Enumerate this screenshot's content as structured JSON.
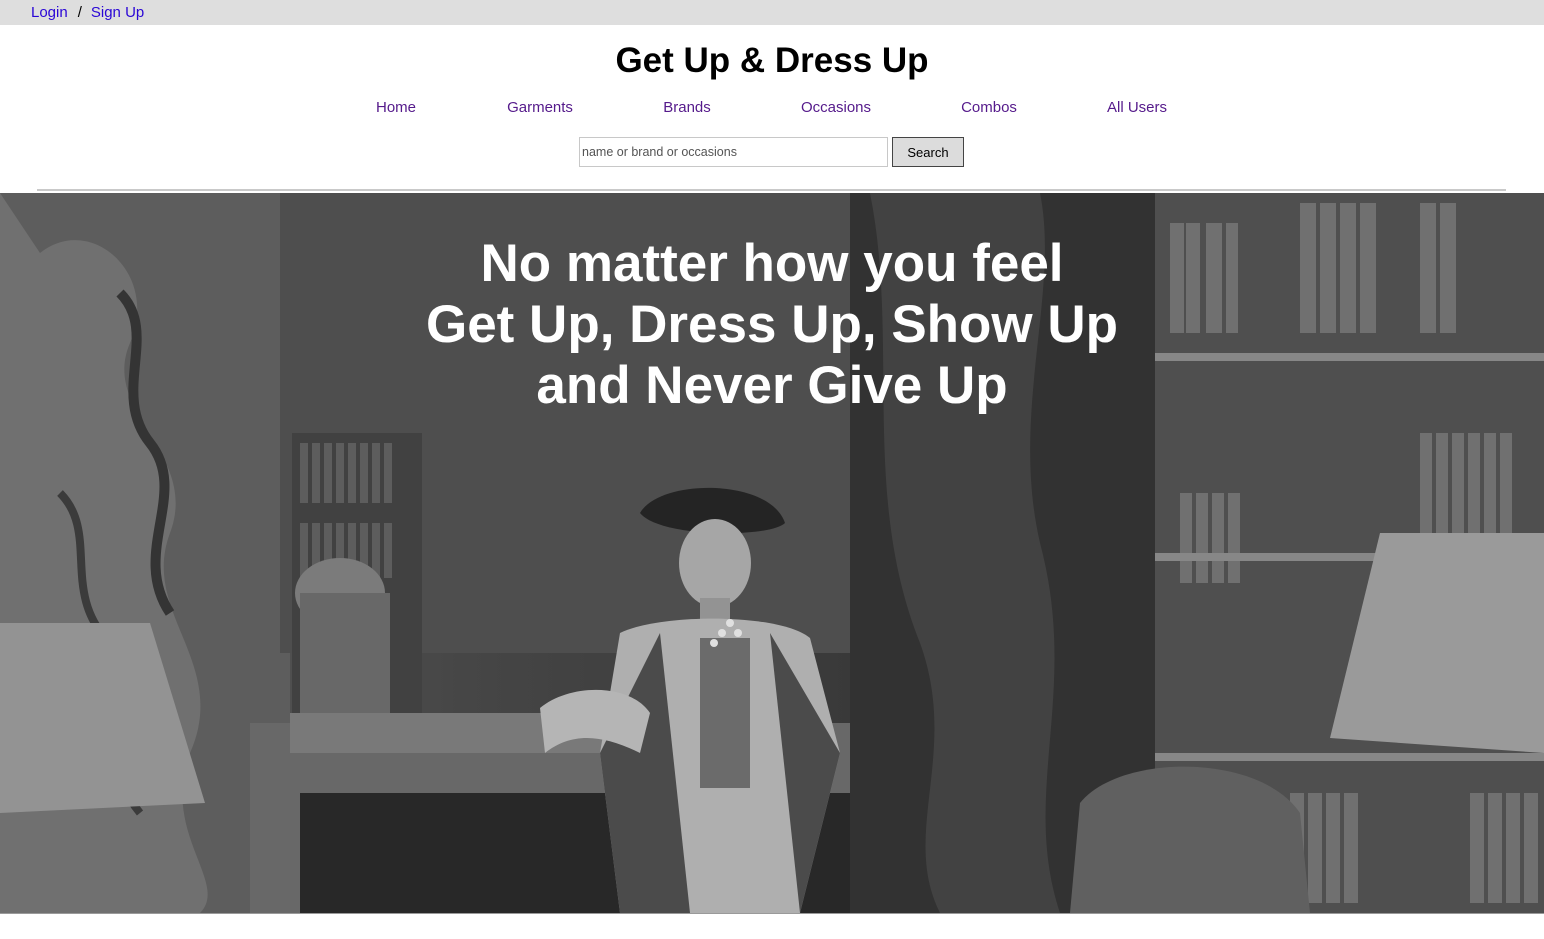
{
  "auth": {
    "login": "Login",
    "separator": "/",
    "signup": "Sign Up"
  },
  "site": {
    "title": "Get Up & Dress Up"
  },
  "nav": [
    "Home",
    "Garments",
    "Brands",
    "Occasions",
    "Combos",
    "All Users"
  ],
  "search": {
    "placeholder": "name or brand or occasions",
    "value": "",
    "button": "Search"
  },
  "hero": {
    "lines": [
      "No matter how you feel",
      "Get Up, Dress Up, Show Up",
      "and Never Give Up"
    ]
  },
  "colors": {
    "link": "#2a06d6",
    "nav_link": "#551a8b",
    "topbar_bg": "#dedede"
  }
}
